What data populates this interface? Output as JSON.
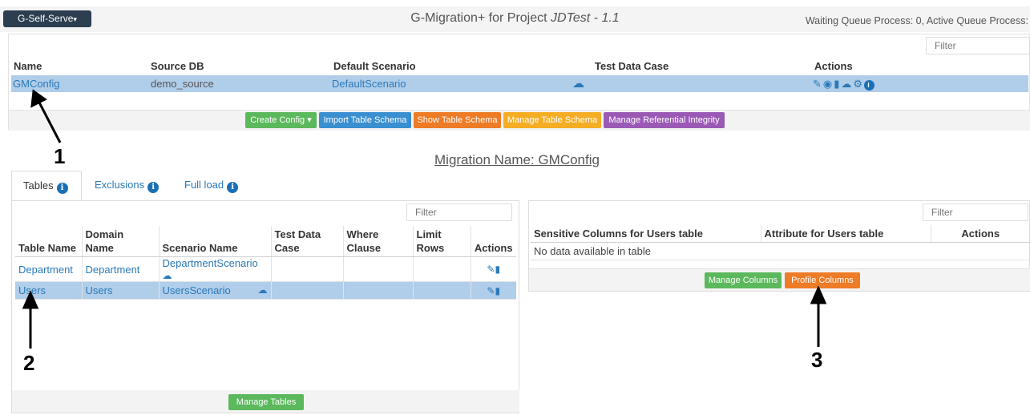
{
  "header": {
    "brand_button": "G-Self-Serve",
    "title_prefix": "G-Migration+ for Project ",
    "project": "JDTest - 1.1",
    "queue_status": "Waiting Queue Process: 0, Active Queue Process:"
  },
  "config_table": {
    "filter_placeholder": "Filter",
    "columns": [
      "Name",
      "Source DB",
      "Default Scenario",
      "Test Data Case",
      "Actions"
    ],
    "rows": [
      {
        "name": "GMConfig",
        "source_db": "demo_source",
        "default_scenario": "DefaultScenario"
      }
    ],
    "action_icons": [
      "edit-icon",
      "view-icon",
      "delete-icon",
      "cloud-download-icon",
      "migrate-icon",
      "info-icon"
    ]
  },
  "config_buttons": {
    "create": "Create Config",
    "import": "Import Table Schema",
    "show": "Show Table Schema",
    "manage_schema": "Manage Table Schema",
    "manage_ri": "Manage Referential Integrity"
  },
  "migration_title": "Migration Name: GMConfig",
  "tabs": [
    "Tables",
    "Exclusions",
    "Full load"
  ],
  "tables_table": {
    "filter_placeholder": "Filter",
    "columns": [
      {
        "line1": "",
        "line2": "Table Name"
      },
      {
        "line1": "Domain",
        "line2": "Name"
      },
      {
        "line1": "",
        "line2": "Scenario Name"
      },
      {
        "line1": "Test Data",
        "line2": "Case"
      },
      {
        "line1": "Where",
        "line2": "Clause"
      },
      {
        "line1": "Limit",
        "line2": "Rows"
      },
      {
        "line1": "",
        "line2": "Actions"
      }
    ],
    "rows": [
      {
        "table": "Department",
        "domain": "Department",
        "scenario": "DepartmentScenario"
      },
      {
        "table": "Users",
        "domain": "Users",
        "scenario": "UsersScenario"
      }
    ],
    "manage_button": "Manage Tables"
  },
  "columns_panel": {
    "filter_placeholder": "Filter",
    "columns": [
      "Sensitive Columns for Users table",
      "Attribute for Users table",
      "Actions"
    ],
    "empty_text": "No data available in table",
    "manage_button": "Manage Columns",
    "profile_button": "Profile Columns"
  },
  "annotations": [
    "1",
    "2",
    "3"
  ],
  "colors": {
    "selected_row": "#b0cdea",
    "link": "#2a7ab8",
    "green": "#5cb85c",
    "blue": "#3a8fd0",
    "orange": "#ee7b26",
    "yellow": "#f5ad24",
    "purple": "#9b59b6"
  }
}
